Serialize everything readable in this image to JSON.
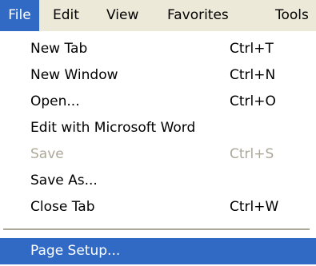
{
  "menubar": {
    "items": [
      {
        "label": "File"
      },
      {
        "label": "Edit"
      },
      {
        "label": "View"
      },
      {
        "label": "Favorites"
      },
      {
        "label": "Tools"
      }
    ]
  },
  "file_menu": {
    "items": [
      {
        "label": "New Tab",
        "shortcut": "Ctrl+T"
      },
      {
        "label": "New Window",
        "shortcut": "Ctrl+N"
      },
      {
        "label": "Open...",
        "shortcut": "Ctrl+O"
      },
      {
        "label": "Edit with Microsoft Word",
        "shortcut": ""
      },
      {
        "label": "Save",
        "shortcut": "Ctrl+S"
      },
      {
        "label": "Save As...",
        "shortcut": ""
      },
      {
        "label": "Close Tab",
        "shortcut": "Ctrl+W"
      },
      {
        "label": "Page Setup...",
        "shortcut": ""
      }
    ]
  },
  "colors": {
    "highlight": "#316ac5",
    "menubar_background": "#ece9d8",
    "disabled_text": "#aca899"
  }
}
